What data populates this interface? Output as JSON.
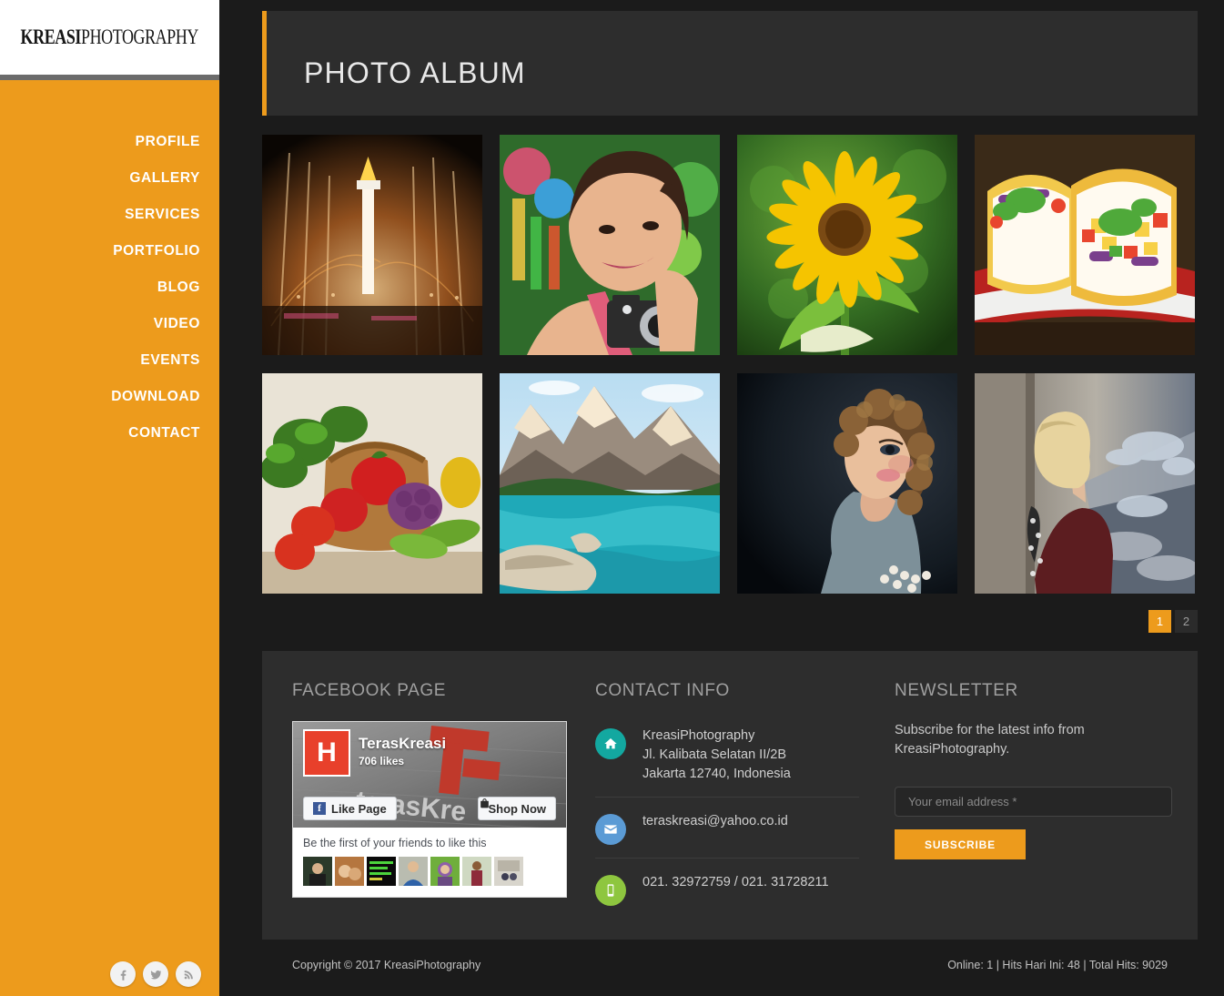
{
  "brand": {
    "logo_bold": "KREASI",
    "logo_light": "PHOTOGRAPHY",
    "accent_color": "#ed9b1c",
    "panel_color": "#2d2d2d",
    "background_color": "#1b1b1b"
  },
  "sidebar": {
    "items": [
      {
        "label": "PROFILE",
        "name": "profile"
      },
      {
        "label": "GALLERY",
        "name": "gallery"
      },
      {
        "label": "SERVICES",
        "name": "services"
      },
      {
        "label": "PORTFOLIO",
        "name": "portfolio"
      },
      {
        "label": "BLOG",
        "name": "blog"
      },
      {
        "label": "VIDEO",
        "name": "video"
      },
      {
        "label": "EVENTS",
        "name": "events"
      },
      {
        "label": "DOWNLOAD",
        "name": "download"
      },
      {
        "label": "CONTACT",
        "name": "contact"
      }
    ],
    "social": [
      {
        "icon": "facebook-icon",
        "label": "Facebook"
      },
      {
        "icon": "twitter-icon",
        "label": "Twitter"
      },
      {
        "icon": "rss-icon",
        "label": "RSS"
      }
    ]
  },
  "header": {
    "title": "PHOTO ALBUM"
  },
  "gallery": {
    "photos": [
      {
        "alt": "Monas monument at night with illuminated fountains",
        "theme": "monas-night"
      },
      {
        "alt": "Young woman smiling while using a camera",
        "theme": "woman-camera"
      },
      {
        "alt": "Yellow sunflower on green background",
        "theme": "sunflower"
      },
      {
        "alt": "Fish tacos with mango salsa on red plate",
        "theme": "tacos"
      },
      {
        "alt": "Basket of fresh vegetables and fruit",
        "theme": "vegetables"
      },
      {
        "alt": "Turquoise mountain lake with driftwood",
        "theme": "mountain-lake"
      },
      {
        "alt": "Glamour portrait of woman with curly hair",
        "theme": "glamour-portrait"
      },
      {
        "alt": "Blonde woman in leather coat on a street",
        "theme": "street-woman"
      }
    ]
  },
  "pagination": {
    "pages": [
      {
        "label": "1",
        "active": true
      },
      {
        "label": "2",
        "active": false
      }
    ]
  },
  "footer": {
    "facebook": {
      "title": "FACEBOOK PAGE",
      "page_name": "TerasKreasi",
      "likes": "706 likes",
      "like_button": "Like Page",
      "shop_button": "Shop Now",
      "friends_text": "Be the first of your friends to like this"
    },
    "contact": {
      "title": "CONTACT INFO",
      "address_line1": "KreasiPhotography",
      "address_line2": "Jl. Kalibata Selatan II/2B",
      "address_line3": "Jakarta 12740, Indonesia",
      "email": "teraskreasi@yahoo.co.id",
      "phone": "021. 32972759 / 021. 31728211",
      "icon_colors": {
        "home": "#13a8a0",
        "mail": "#5b9bd5",
        "phone": "#8ec63f"
      }
    },
    "newsletter": {
      "title": "NEWSLETTER",
      "description": "Subscribe for the latest info from KreasiPhotography.",
      "input_placeholder": "Your email address *",
      "input_value": "",
      "button_label": "SUBSCRIBE"
    },
    "copyright": "Copyright © 2017 KreasiPhotography",
    "stats": "Online: 1 | Hits Hari Ini: 48 | Total Hits: 9029"
  }
}
